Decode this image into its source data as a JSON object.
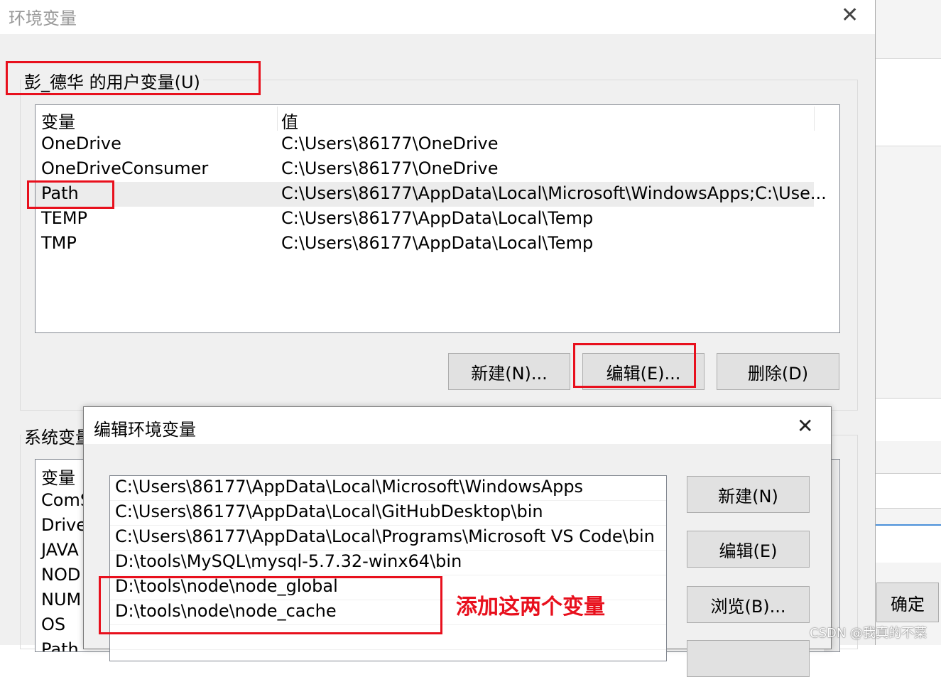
{
  "main_window": {
    "title": "环境变量",
    "user_vars_label": "彭_德华 的用户变量(U)",
    "user_vars": {
      "columns": [
        "变量",
        "值"
      ],
      "rows": [
        {
          "name": "OneDrive",
          "value": "C:\\Users\\86177\\OneDrive"
        },
        {
          "name": "OneDriveConsumer",
          "value": "C:\\Users\\86177\\OneDrive"
        },
        {
          "name": "Path",
          "value": "C:\\Users\\86177\\AppData\\Local\\Microsoft\\WindowsApps;C:\\Use..."
        },
        {
          "name": "TEMP",
          "value": "C:\\Users\\86177\\AppData\\Local\\Temp"
        },
        {
          "name": "TMP",
          "value": "C:\\Users\\86177\\AppData\\Local\\Temp"
        }
      ],
      "selected_row": 2
    },
    "user_buttons": {
      "new": "新建(N)...",
      "edit": "编辑(E)...",
      "delete": "删除(D)"
    },
    "system_vars_label": "系统变量",
    "system_vars": {
      "column": "变量",
      "rows": [
        "ComS",
        "Drive",
        "JAVA",
        "NOD",
        "NUM",
        "OS",
        "Path"
      ]
    }
  },
  "edit_dialog": {
    "title": "编辑环境变量",
    "entries": [
      "C:\\Users\\86177\\AppData\\Local\\Microsoft\\WindowsApps",
      "C:\\Users\\86177\\AppData\\Local\\GitHubDesktop\\bin",
      "C:\\Users\\86177\\AppData\\Local\\Programs\\Microsoft VS Code\\bin",
      "D:\\tools\\MySQL\\mysql-5.7.32-winx64\\bin",
      "D:\\tools\\node\\node_global",
      "D:\\tools\\node\\node_cache"
    ],
    "buttons": {
      "new": "新建(N)",
      "edit": "编辑(E)",
      "browse": "浏览(B)..."
    }
  },
  "background_window": {
    "ok_button": "确定"
  },
  "annotation": "添加这两个变量",
  "watermark": "CSDN @我真的不菜",
  "colors": {
    "highlight": "#e8101d",
    "selection": "#ececec",
    "dialog_bg": "#f0f0f0"
  }
}
